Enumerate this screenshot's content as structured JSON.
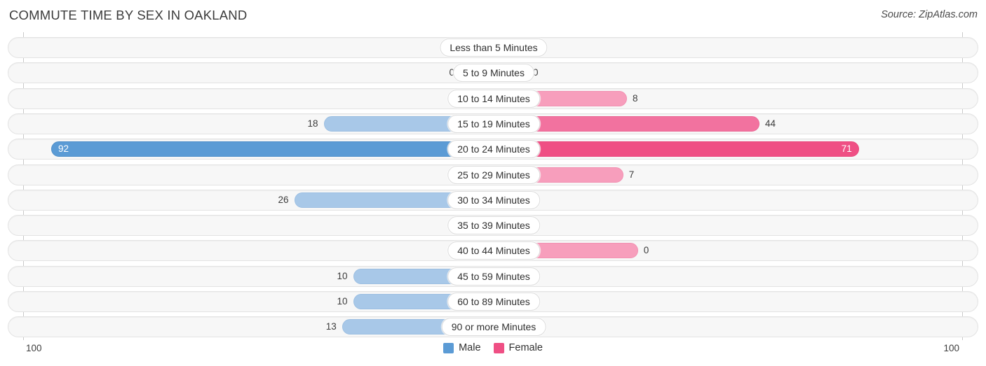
{
  "header": {
    "title": "COMMUTE TIME BY SEX IN OAKLAND",
    "source": "Source: ZipAtlas.com"
  },
  "axis": {
    "left_max": "100",
    "right_max": "100"
  },
  "legend": [
    {
      "label": "Male",
      "color": "#5b9bd5",
      "icon": "square-swatch-icon"
    },
    {
      "label": "Female",
      "color": "#ef4f84",
      "icon": "square-swatch-icon"
    }
  ],
  "colors": {
    "male_light": "#a8c8e8",
    "male_strong": "#5b9bd5",
    "female_light": "#f79ebc",
    "female_mid": "#f2729f",
    "female_strong": "#ef4f84",
    "track": "#f7f7f7",
    "track_border": "#e3e3e3",
    "axis": "#c9c9c9"
  },
  "chart_data": {
    "type": "bar",
    "subtype": "diverging-bidirectional",
    "title": "COMMUTE TIME BY SEX IN OAKLAND",
    "xlabel": "",
    "ylabel": "",
    "xlim": [
      100,
      0,
      100
    ],
    "grid": false,
    "legend_position": "bottom-center",
    "categories": [
      "Less than 5 Minutes",
      "5 to 9 Minutes",
      "10 to 14 Minutes",
      "15 to 19 Minutes",
      "20 to 24 Minutes",
      "25 to 29 Minutes",
      "30 to 34 Minutes",
      "35 to 39 Minutes",
      "40 to 44 Minutes",
      "45 to 59 Minutes",
      "60 to 89 Minutes",
      "90 or more Minutes"
    ],
    "series": [
      {
        "name": "Male",
        "direction": "left",
        "values": [
          0,
          0,
          0,
          18,
          92,
          0,
          26,
          0,
          0,
          10,
          10,
          13
        ]
      },
      {
        "name": "Female",
        "direction": "right",
        "values": [
          0,
          0,
          8,
          44,
          71,
          7,
          0,
          0,
          11,
          0,
          0,
          0
        ]
      }
    ]
  },
  "rows": [
    {
      "label": "Less than 5 Minutes",
      "male": "0",
      "female": "0"
    },
    {
      "label": "5 to 9 Minutes",
      "male": "0",
      "female": "0"
    },
    {
      "label": "10 to 14 Minutes",
      "male": "0",
      "female": "8"
    },
    {
      "label": "15 to 19 Minutes",
      "male": "18",
      "female": "44"
    },
    {
      "label": "20 to 24 Minutes",
      "male": "92",
      "female": "71"
    },
    {
      "label": "25 to 29 Minutes",
      "male": "0",
      "female": "7"
    },
    {
      "label": "30 to 34 Minutes",
      "male": "26",
      "female": "0"
    },
    {
      "label": "35 to 39 Minutes",
      "male": "0",
      "female": "0"
    },
    {
      "label": "40 to 44 Minutes",
      "male": "0",
      "female": "0"
    },
    {
      "label": "45 to 59 Minutes",
      "male": "10",
      "female": "0"
    },
    {
      "label": "60 to 89 Minutes",
      "male": "10",
      "female": "0"
    },
    {
      "label": "90 or more Minutes",
      "male": "13",
      "female": "0"
    }
  ]
}
